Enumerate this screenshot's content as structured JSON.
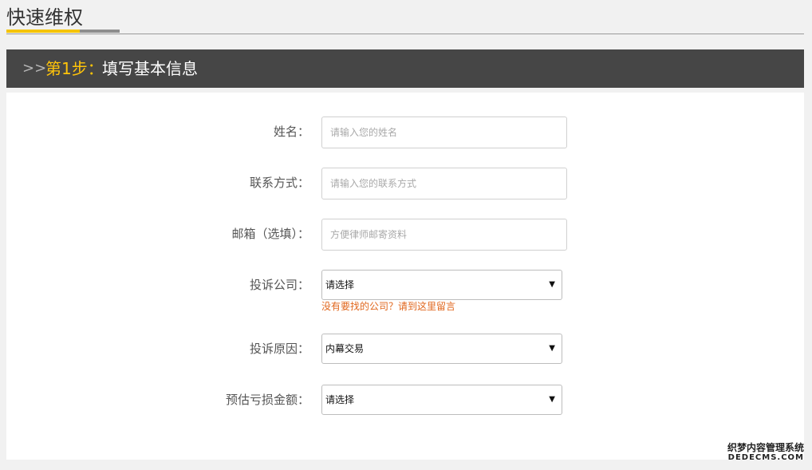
{
  "header": {
    "title": "快速维权",
    "accent_color": "#f5c400"
  },
  "step": {
    "arrows": ">>",
    "number_label": "第1步：",
    "title": "填写基本信息"
  },
  "form": {
    "name": {
      "label": "姓名：",
      "value": "",
      "placeholder": "请输入您的姓名"
    },
    "contact": {
      "label": "联系方式：",
      "value": "",
      "placeholder": "请输入您的联系方式"
    },
    "email": {
      "label": "邮箱（选填）：",
      "value": "",
      "placeholder": "方便律师邮寄资料"
    },
    "company": {
      "label": "投诉公司：",
      "selected": "请选择",
      "help_link": "没有要找的公司？请到这里留言"
    },
    "reason": {
      "label": "投诉原因：",
      "selected": "内幕交易"
    },
    "loss": {
      "label": "预估亏损金额：",
      "selected": "请选择"
    }
  },
  "watermark": {
    "line1": "织梦内容管理系统",
    "line2": "DEDECMS.COM"
  },
  "colors": {
    "step_bar": "#464646",
    "step_number": "#ffc40a",
    "help_link": "#e0661c"
  }
}
